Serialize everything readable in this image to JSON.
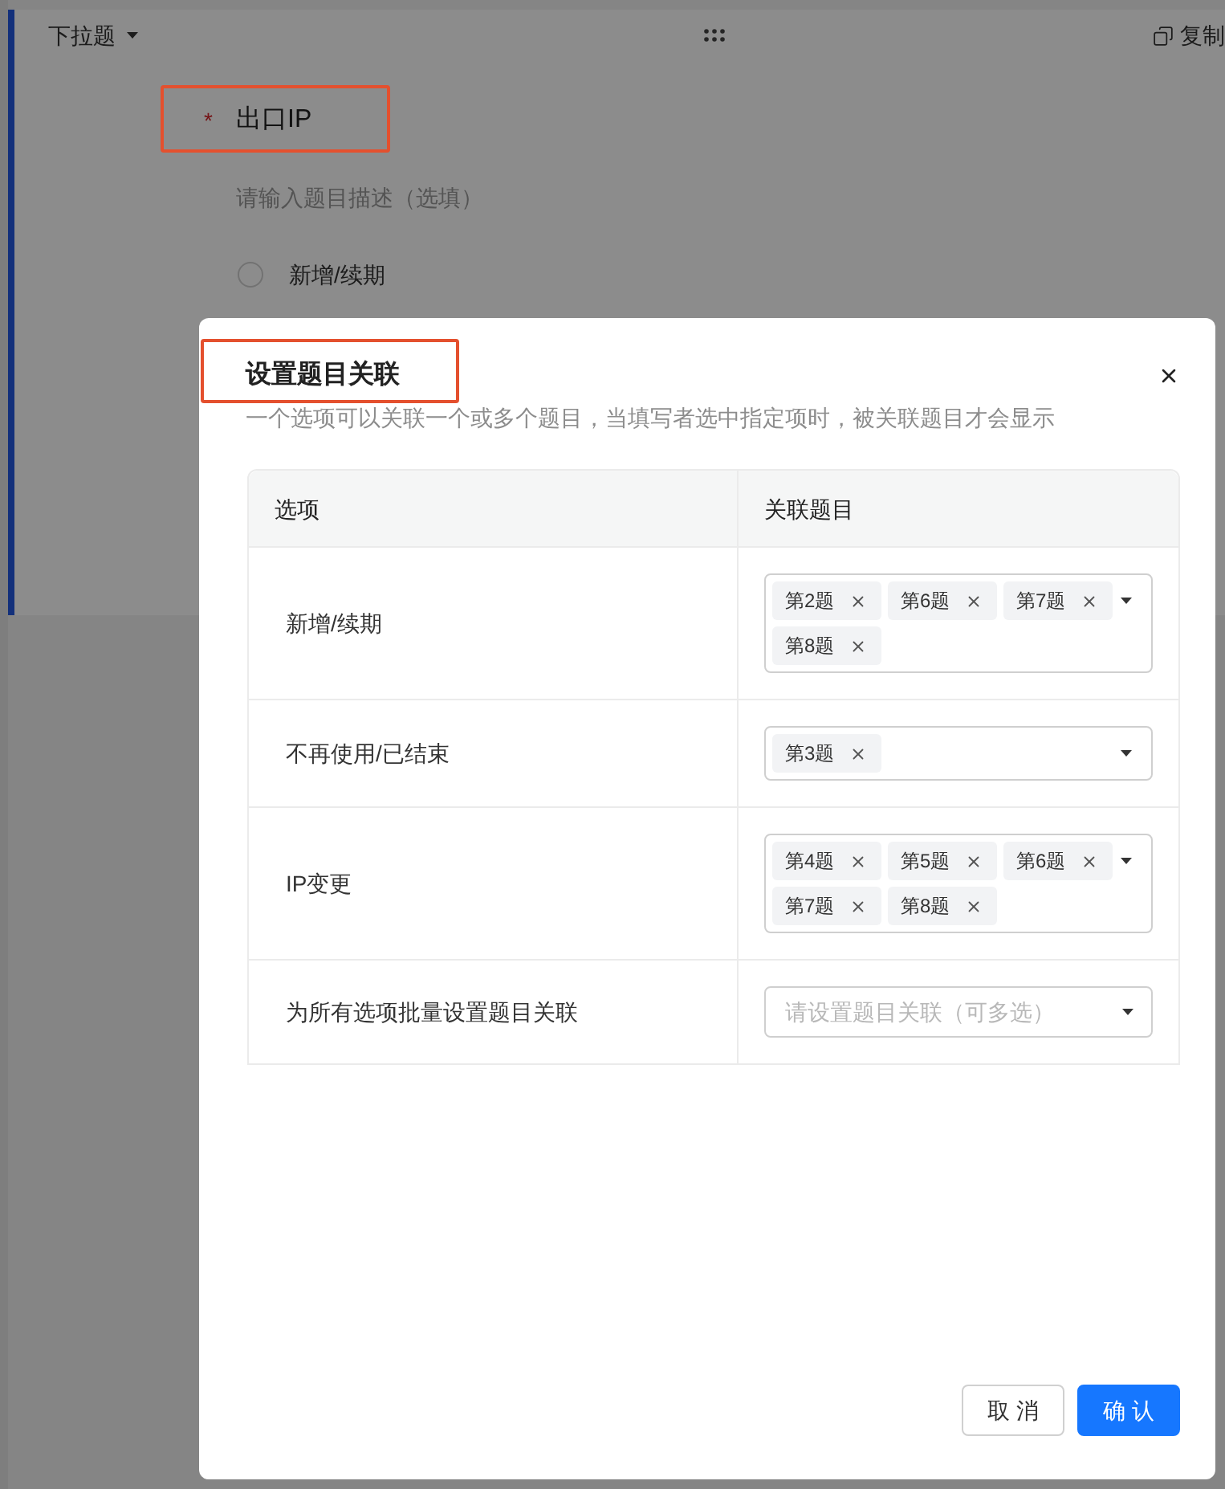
{
  "editor": {
    "question_type": "下拉题",
    "copy_label": "复制",
    "required_mark": "*",
    "title": "出口IP",
    "description": {
      "placeholder": "请输入题目描述（选填）"
    },
    "options": [
      {
        "label": "新增/续期",
        "selected": false
      }
    ]
  },
  "dialog": {
    "title": "设置题目关联",
    "subtitle": "一个选项可以关联一个或多个题目，当填写者选中指定项时，被关联题目才会显示",
    "columns": [
      "选项",
      "关联题目"
    ],
    "rows": [
      {
        "option": "新增/续期",
        "tags": [
          "第2题",
          "第6题",
          "第7题",
          "第8题"
        ]
      },
      {
        "option": "不再使用/已结束",
        "tags": [
          "第3题"
        ]
      },
      {
        "option": "IP变更",
        "tags": [
          "第4题",
          "第5题",
          "第6题",
          "第7题",
          "第8题"
        ]
      },
      {
        "option": "为所有选项批量设置题目关联",
        "placeholder": "请设置题目关联（可多选）"
      }
    ],
    "buttons": [
      {
        "label": "取 消",
        "kind": "secondary"
      },
      {
        "label": "确 认",
        "kind": "primary"
      }
    ]
  }
}
